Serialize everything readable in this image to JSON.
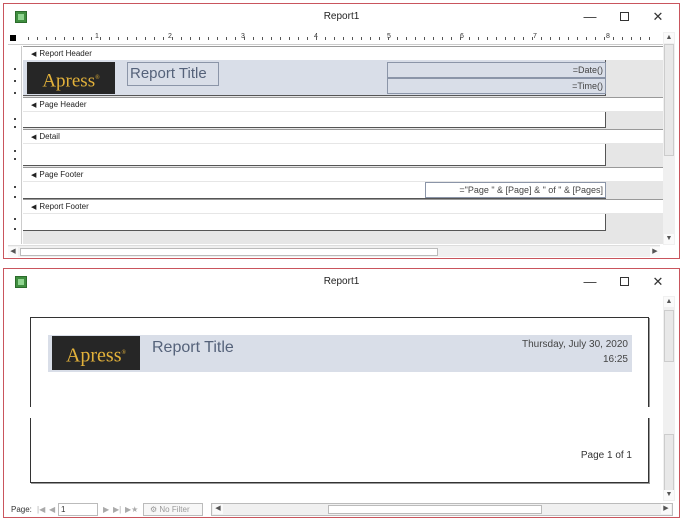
{
  "window1": {
    "title": "Report1",
    "ruler_numbers": [
      "1",
      "2",
      "3",
      "4",
      "5",
      "6",
      "7",
      "8"
    ],
    "sections": {
      "report_header": "Report Header",
      "page_header": "Page Header",
      "detail": "Detail",
      "page_footer": "Page Footer",
      "report_footer": "Report Footer"
    },
    "logo_text": "Apress",
    "logo_mark": "®",
    "title_control": "Report Title",
    "date_control": "=Date()",
    "time_control": "=Time()",
    "page_control": "=\"Page \" & [Page] & \" of \" & [Pages]"
  },
  "window2": {
    "title": "Report1",
    "logo_text": "Apress",
    "logo_mark": "®",
    "report_title": "Report Title",
    "date": "Thursday, July 30, 2020",
    "time": "16:25",
    "page_number": "Page 1 of 1",
    "status": {
      "page_label": "Page:",
      "page_value": "1",
      "filter_label": "No Filter"
    }
  },
  "icons": [
    "app-icon",
    "minimize-icon",
    "maximize-icon",
    "close-icon",
    "section-arrow-icon",
    "scroll-arrow-icon"
  ]
}
